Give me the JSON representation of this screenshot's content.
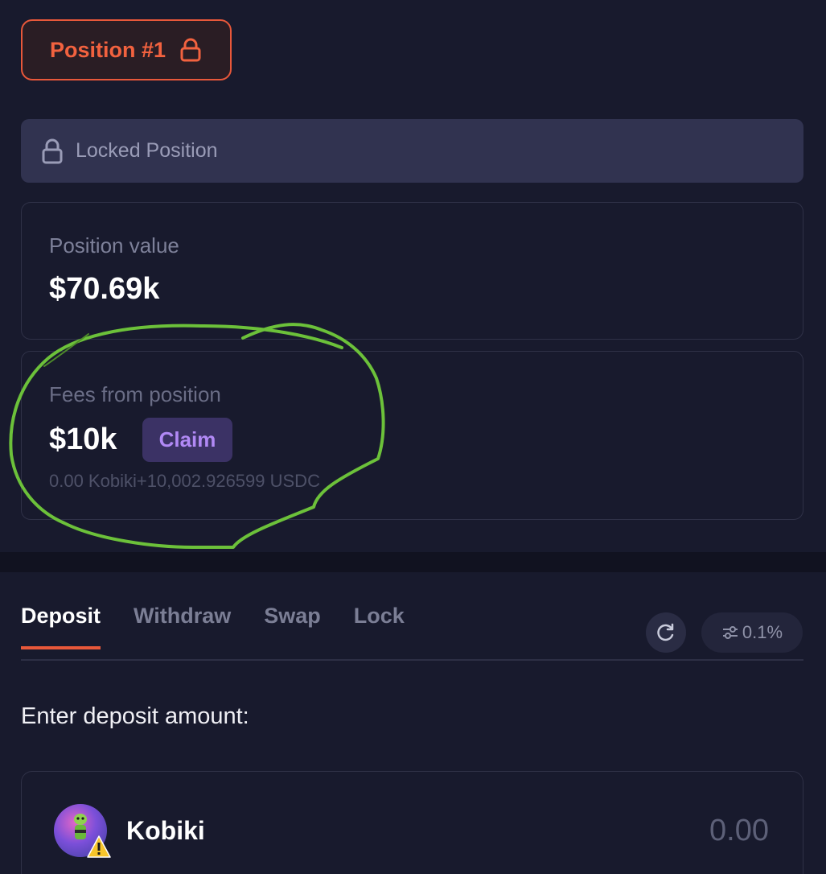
{
  "header": {
    "position_label": "Position #1"
  },
  "locked_banner": {
    "label": "Locked Position"
  },
  "position_value": {
    "label": "Position value",
    "amount": "$70.69k"
  },
  "fees": {
    "label": "Fees from position",
    "amount": "$10k",
    "claim_label": "Claim",
    "detail": "0.00 Kobiki+10,002.926599 USDC"
  },
  "tabs": [
    {
      "label": "Deposit",
      "active": true
    },
    {
      "label": "Withdraw",
      "active": false
    },
    {
      "label": "Swap",
      "active": false
    },
    {
      "label": "Lock",
      "active": false
    }
  ],
  "controls": {
    "slippage": "0.1%",
    "refresh_icon": "refresh-icon",
    "slippage_icon": "sliders-icon"
  },
  "deposit": {
    "prompt": "Enter deposit amount:",
    "token_name": "Kobiki",
    "amount": "0.00"
  },
  "colors": {
    "accent": "#e8583a",
    "claim": "#b189f5",
    "background": "#181a2d",
    "annotation": "#6cc13a"
  }
}
